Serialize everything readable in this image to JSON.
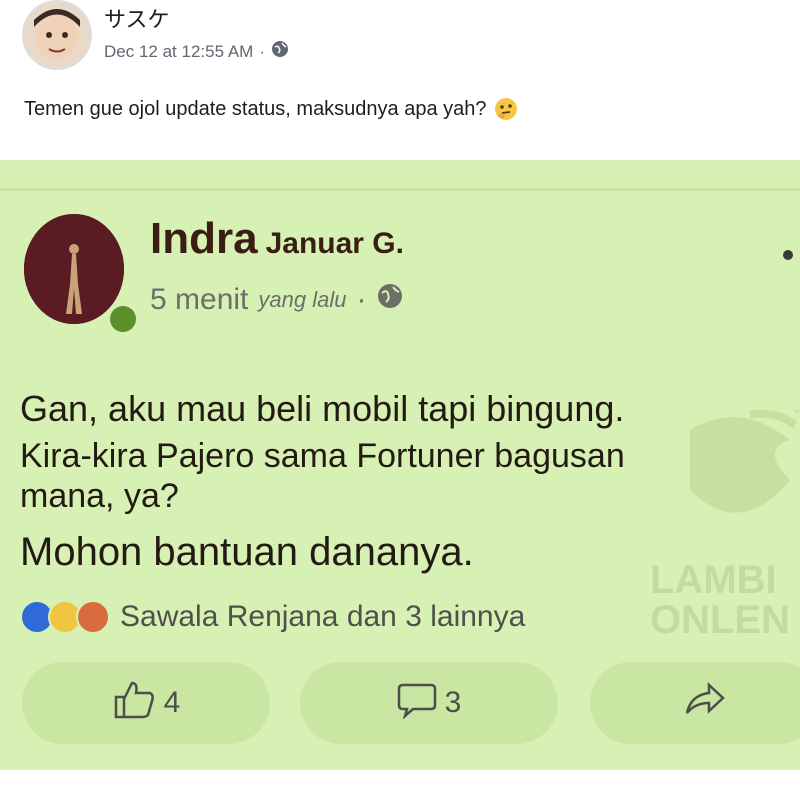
{
  "outer_post": {
    "author": "サスケ",
    "timestamp": "Dec 12 at 12:55 AM",
    "separator": "·",
    "text": "Temen gue ojol update status, maksudnya apa yah?",
    "emoji_icon": "thinking-face-icon",
    "privacy_icon": "globe-icon"
  },
  "inner_post": {
    "author_first": "Indra",
    "author_last": "Januar G.",
    "time_number": "5 menit",
    "time_suffix": "yang lalu",
    "separator": "·",
    "privacy_icon": "globe-icon",
    "lines": [
      "Gan, aku mau beli mobil tapi bingung.",
      "Kira-kira Pajero sama Fortuner bagusan",
      "mana, ya?",
      "Mohon bantuan dananya."
    ],
    "reactions_text": "Sawala Renjana dan 3 lainnya",
    "reaction_icons": [
      "like-reaction-icon",
      "haha-reaction-icon",
      "angry-reaction-icon"
    ],
    "like_count": "4",
    "comment_count": "3"
  },
  "watermark": {
    "line1": "LAMBI",
    "line2": "ONLEN"
  },
  "colors": {
    "inner_background": "#d7f1b4",
    "action_pill": "#c9e7a2",
    "author_text": "#3a1e14"
  }
}
